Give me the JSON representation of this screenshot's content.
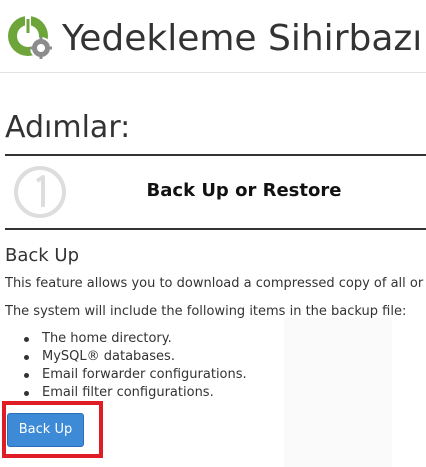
{
  "header": {
    "title": "Yedekleme Sihirbazı",
    "icon": "backup-wizard-icon",
    "colors": {
      "icon_green": "#6da53a",
      "icon_gray": "#8c8c8c"
    }
  },
  "steps": {
    "heading": "Adımlar:",
    "current_step": {
      "number_icon": "number-1-circle-icon",
      "title": "Back Up or Restore"
    }
  },
  "main": {
    "section_title": "Back Up",
    "description_1": "This feature allows you to download a compressed copy of all or",
    "description_2": "The system will include the following items in the backup file:",
    "items": [
      "The home directory.",
      "MySQL® databases.",
      "Email forwarder configurations.",
      "Email filter configurations."
    ],
    "button_label": "Back Up",
    "colors": {
      "button": "#3d8ad6",
      "highlight": "#e01c24"
    }
  }
}
